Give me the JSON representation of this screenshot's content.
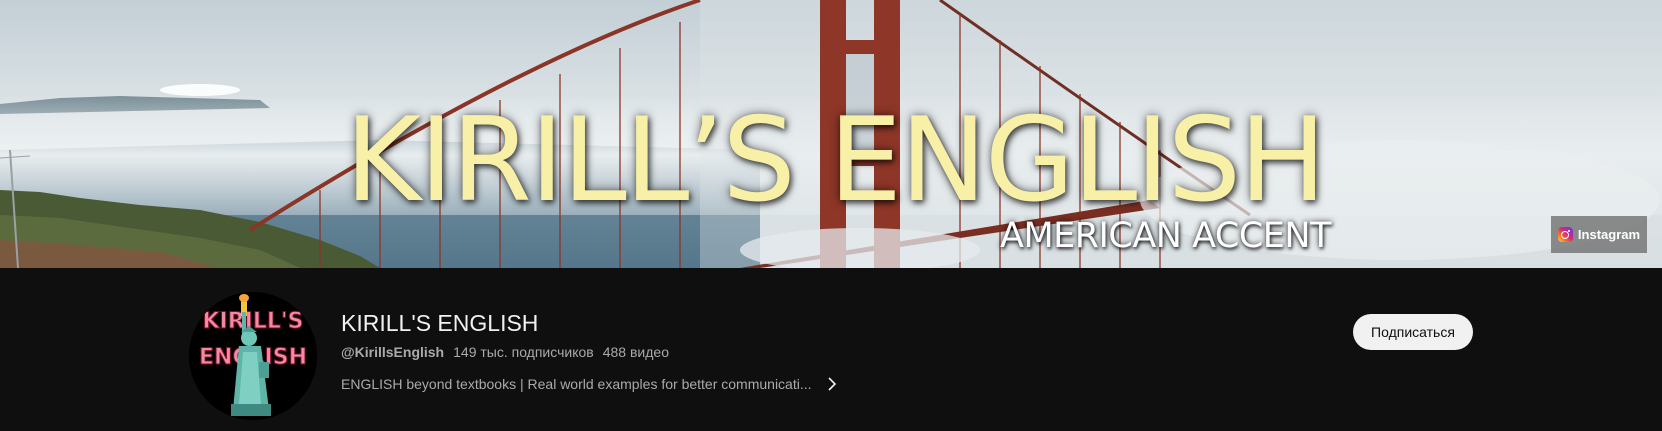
{
  "banner": {
    "title": "KIRILL’S ENGLISH",
    "subtitle": "AMERICAN ACCENT",
    "link_label": "Instagram",
    "link_icon": "instagram-icon",
    "colors": {
      "title": "#f7f0a6",
      "bridge": "#8a3527",
      "water": "#5f7f92",
      "fog": "#e2e8eb"
    }
  },
  "channel": {
    "name": "KIRILL'S ENGLISH",
    "handle": "@KirillsEnglish",
    "subscribers": "149 тыс. подписчиков",
    "videos": "488 видео",
    "description": "ENGLISH beyond textbooks | Real world examples for better communicati...",
    "description_icon": "chevron-right-icon",
    "subscribe_label": "Подписаться",
    "avatar": {
      "logo_text_top": "KIRILL'S",
      "logo_text_bottom": "ENGLISH",
      "logo_icon": "statue-of-liberty-icon"
    }
  },
  "colors": {
    "background": "#0f0f0f",
    "primary_text": "#f1f1f1",
    "secondary_text": "#aaaaaa",
    "button_bg": "#f1f1f1"
  }
}
